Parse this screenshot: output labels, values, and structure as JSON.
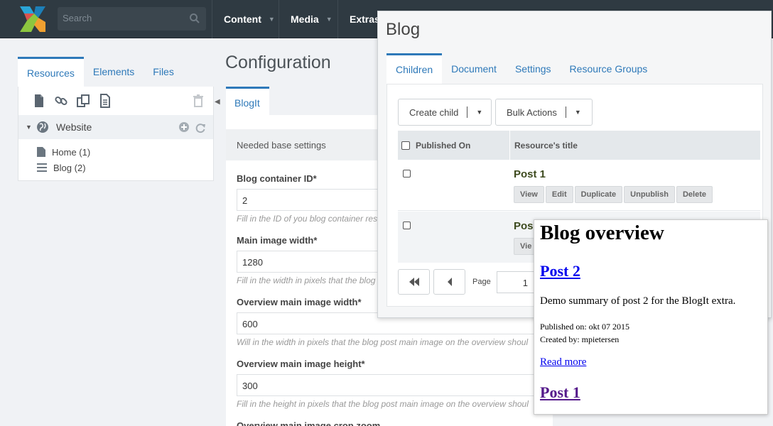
{
  "topbar": {
    "search_placeholder": "Search",
    "nav": [
      {
        "label": "Content"
      },
      {
        "label": "Media"
      },
      {
        "label": "Extras"
      }
    ]
  },
  "left_panel": {
    "tabs": [
      "Resources",
      "Elements",
      "Files"
    ],
    "active_tab": "Resources",
    "toolbar_icons": [
      "new-document-icon",
      "weblink-icon",
      "symlink-icon",
      "static-resource-icon",
      "trash-icon"
    ],
    "tree": {
      "root": "Website",
      "items": [
        {
          "label": "Home (1)",
          "icon": "document-icon"
        },
        {
          "label": "Blog (2)",
          "icon": "list-icon"
        }
      ]
    }
  },
  "config": {
    "title": "Configuration",
    "tab": "BlogIt",
    "section": "Needed base settings",
    "fields": [
      {
        "label": "Blog container ID*",
        "value": "2",
        "help": "Fill in the ID of you blog container res"
      },
      {
        "label": "Main image width*",
        "value": "1280",
        "help": "Fill in the width in pixels that the blog"
      },
      {
        "label": "Overview main image width*",
        "value": "600",
        "help": "Will in the width in pixels that the blog post main image on the overview shoul"
      },
      {
        "label": "Overview main image height*",
        "value": "300",
        "help": "Fill in the height in pixels that the blog post main image on the overview shoul"
      },
      {
        "label": "Overview main image crop zoom",
        "value": "",
        "help": ""
      }
    ]
  },
  "blog_window": {
    "title": "Blog",
    "tabs": [
      "Children",
      "Document",
      "Settings",
      "Resource Groups"
    ],
    "active_tab": "Children",
    "buttons": {
      "create_child": "Create child",
      "bulk_actions": "Bulk Actions"
    },
    "columns": [
      "Published On",
      "Resource's title"
    ],
    "rows": [
      {
        "title": "Post 1",
        "actions": [
          "View",
          "Edit",
          "Duplicate",
          "Unpublish",
          "Delete"
        ]
      },
      {
        "title": "Pos",
        "actions": [
          "Vie"
        ]
      }
    ],
    "pager": {
      "page_label": "Page",
      "page_value": "1"
    }
  },
  "preview": {
    "heading": "Blog overview",
    "post2_title": "Post 2",
    "post2_summary": "Demo summary of post 2 for the BlogIt extra.",
    "published": "Published on: okt 07 2015",
    "created_by": "Created by: mpietersen",
    "read_more": "Read more",
    "post1_title": "Post 1"
  },
  "colors": {
    "accent": "#2e79b9",
    "topbar": "#2f3a42",
    "link": "#0000ee",
    "visited": "#551a8b"
  }
}
